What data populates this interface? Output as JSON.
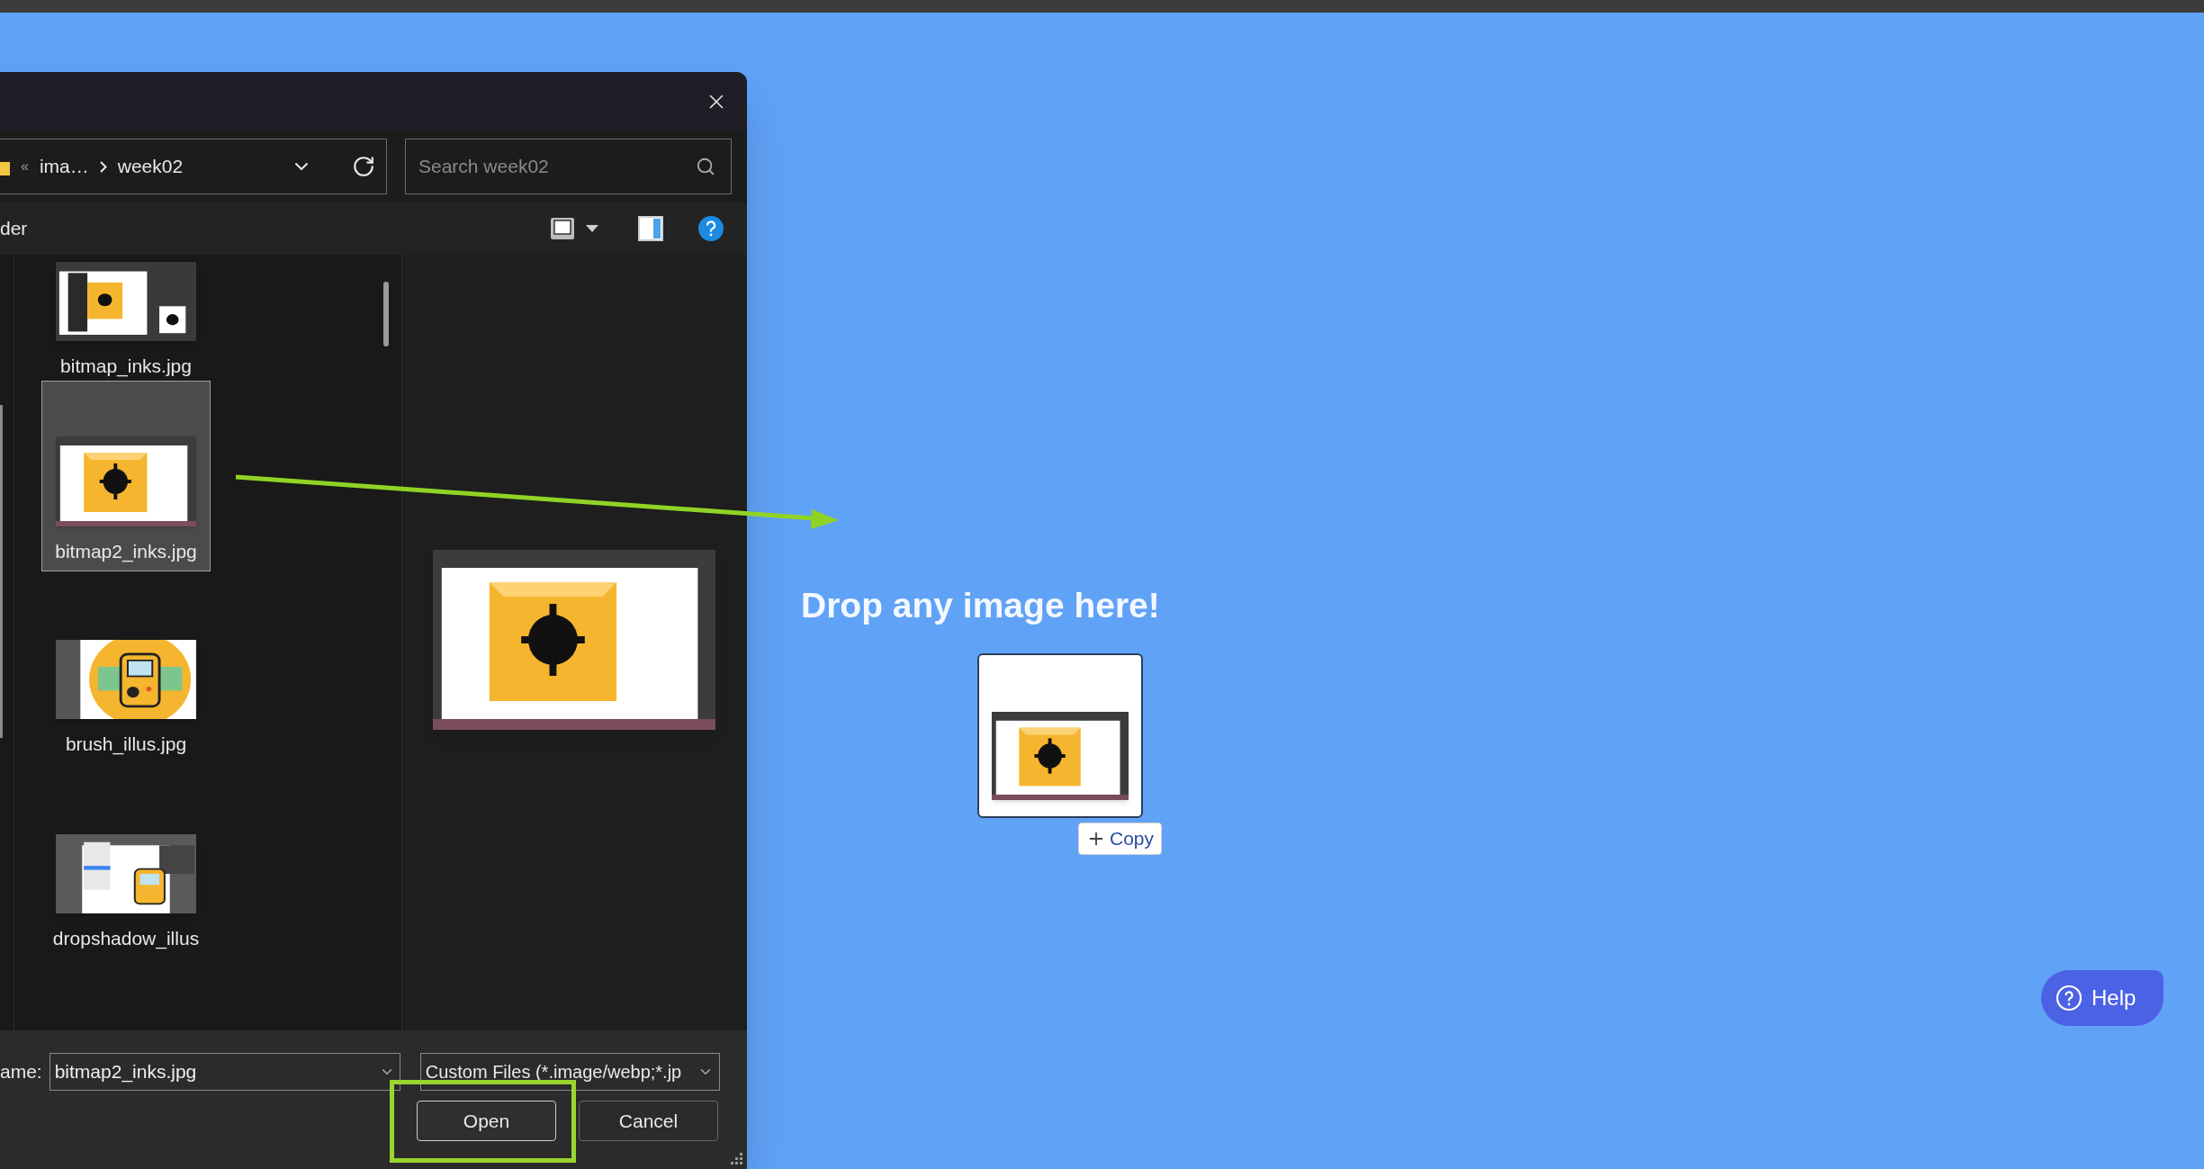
{
  "dialog": {
    "address": {
      "overflow": "«",
      "parent": "ima…",
      "current": "week02"
    },
    "search": {
      "placeholder": "Search week02"
    },
    "toolbar_label": "der",
    "files": [
      {
        "name": "bitmap_inks.jpg",
        "selected": false
      },
      {
        "name": "bitmap2_inks.jpg",
        "selected": true
      },
      {
        "name": "brush_illus.jpg",
        "selected": false
      },
      {
        "name": "dropshadow_illus",
        "selected": false
      }
    ],
    "file_name": {
      "label": "ame:",
      "value": "bitmap2_inks.jpg"
    },
    "file_type": {
      "value": "Custom Files (*.image/webp;*.jp"
    },
    "buttons": [
      {
        "label": "Open",
        "kind": "primary"
      },
      {
        "label": "Cancel",
        "kind": "secondary"
      }
    ]
  },
  "drop_zone": {
    "heading": "Drop any image here!",
    "copy_label": "Copy"
  },
  "help_button": {
    "label": "Help"
  }
}
